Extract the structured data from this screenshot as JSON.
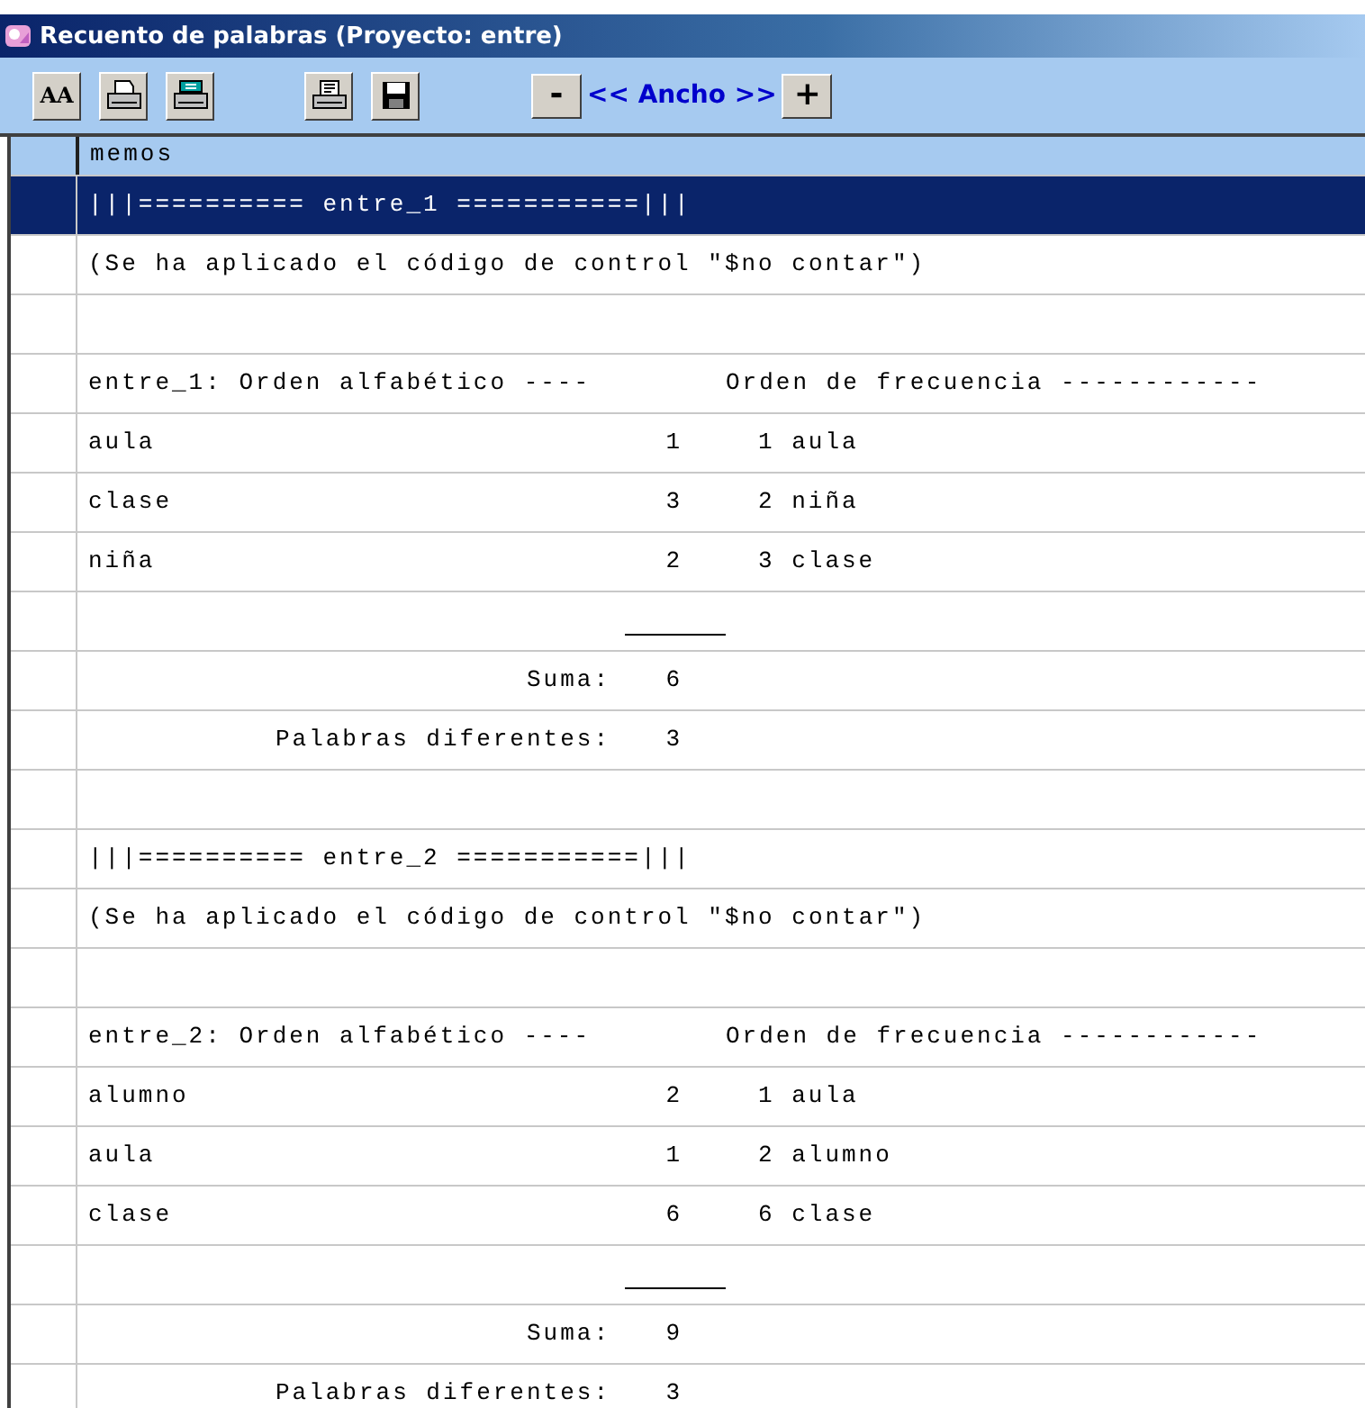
{
  "window": {
    "title": "Recuento de palabras (Proyecto: entre)"
  },
  "toolbar": {
    "buttons": [
      {
        "kind": "font",
        "label": "AA"
      },
      {
        "kind": "print"
      },
      {
        "kind": "print-setup"
      },
      {
        "kind": "print-preview"
      },
      {
        "kind": "save"
      }
    ],
    "width_control": {
      "minus": "-",
      "label": "<< Ancho >>",
      "plus": "+"
    }
  },
  "grid": {
    "header": "memos",
    "rows": [
      {
        "kind": "text",
        "selected": true,
        "text": "|||========== entre_1 ===========|||"
      },
      {
        "kind": "text",
        "selected": false,
        "text": "(Se ha aplicado el código de control \"$no contar\")"
      },
      {
        "kind": "blank",
        "selected": false
      },
      {
        "kind": "heading",
        "selected": false,
        "left": "entre_1: Orden alfabético ----",
        "right": "Orden de frecuencia ------------"
      },
      {
        "kind": "word",
        "selected": false,
        "word": "aula",
        "count": "1",
        "freq": "1 aula"
      },
      {
        "kind": "word",
        "selected": false,
        "word": "clase",
        "count": "3",
        "freq": "2 niña"
      },
      {
        "kind": "word",
        "selected": false,
        "word": "niña",
        "count": "2",
        "freq": "3 clase"
      },
      {
        "kind": "rule",
        "selected": false
      },
      {
        "kind": "total",
        "selected": false,
        "label": "Suma:",
        "value": "6"
      },
      {
        "kind": "total",
        "selected": false,
        "label": "Palabras diferentes:",
        "value": "3"
      },
      {
        "kind": "blank",
        "selected": false
      },
      {
        "kind": "text",
        "selected": false,
        "text": "|||========== entre_2 ===========|||"
      },
      {
        "kind": "text",
        "selected": false,
        "text": "(Se ha aplicado el código de control \"$no contar\")"
      },
      {
        "kind": "blank",
        "selected": false
      },
      {
        "kind": "heading",
        "selected": false,
        "left": "entre_2: Orden alfabético ----",
        "right": "Orden de frecuencia ------------"
      },
      {
        "kind": "word",
        "selected": false,
        "word": "alumno",
        "count": "2",
        "freq": "1 aula"
      },
      {
        "kind": "word",
        "selected": false,
        "word": "aula",
        "count": "1",
        "freq": "2 alumno"
      },
      {
        "kind": "word",
        "selected": false,
        "word": "clase",
        "count": "6",
        "freq": "6 clase"
      },
      {
        "kind": "rule",
        "selected": false
      },
      {
        "kind": "total",
        "selected": false,
        "label": "Suma:",
        "value": "9"
      },
      {
        "kind": "total",
        "selected": false,
        "label": "Palabras diferentes:",
        "value": "3"
      }
    ]
  }
}
